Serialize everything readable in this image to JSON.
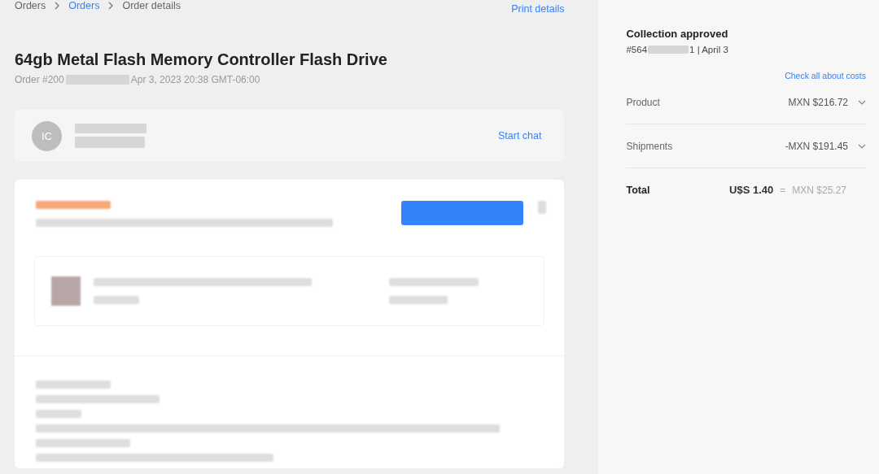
{
  "breadcrumb": [
    {
      "label": "Orders",
      "kind": "plain"
    },
    {
      "label": "Orders",
      "kind": "link"
    },
    {
      "label": "Order details",
      "kind": "plain"
    }
  ],
  "print_link": "Print details",
  "title": "64gb Metal Flash Memory Controller Flash Drive",
  "order_meta": {
    "prefix": "Order #200",
    "date": "Apr 3, 2023 20:38 GMT-06:00"
  },
  "seller": {
    "initials": "IC",
    "action": "Start chat"
  },
  "summary": {
    "status": "Collection approved",
    "ref_prefix": "#564",
    "ref_suffix": "1 | April 3",
    "costs_link": "Check all about costs",
    "rows": [
      {
        "label": "Product",
        "value": "MXN $216.72",
        "expanded": false
      },
      {
        "label": "Shipments",
        "value": "-MXN $191.45",
        "expanded": false
      }
    ],
    "total": {
      "label": "Total",
      "amount": "U$S 1.40",
      "equals": "=",
      "converted": "MXN $25.27"
    }
  }
}
